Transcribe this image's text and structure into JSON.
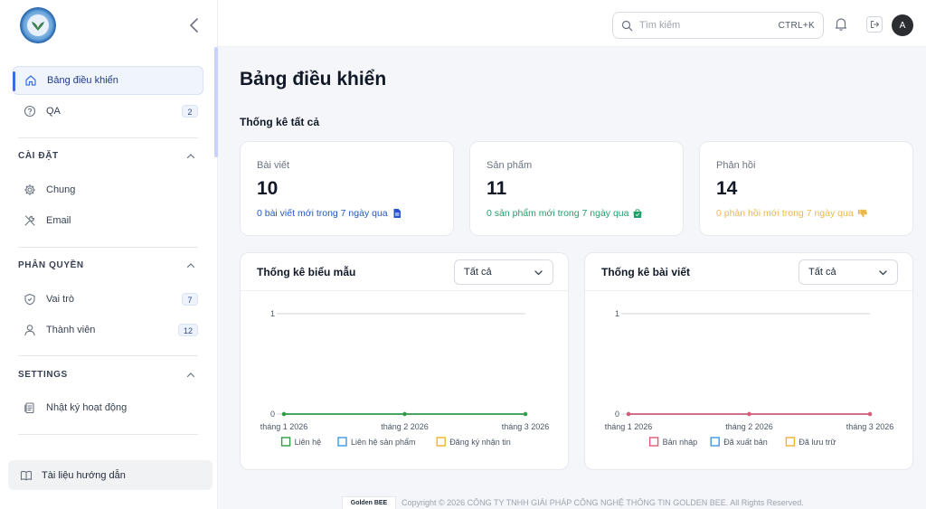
{
  "sidebar": {
    "nav": [
      {
        "label": "Bảng điều khiển",
        "icon": "home-icon",
        "active": true
      },
      {
        "label": "QA",
        "icon": "help-circle-icon",
        "badge": "2"
      }
    ],
    "sections": [
      {
        "title": "CÀI ĐẶT",
        "items": [
          {
            "label": "Chung",
            "icon": "gear-icon"
          },
          {
            "label": "Email",
            "icon": "tools-icon"
          }
        ]
      },
      {
        "title": "PHÂN QUYỀN",
        "items": [
          {
            "label": "Vai trò",
            "icon": "shield-icon",
            "badge": "7"
          },
          {
            "label": "Thành viên",
            "icon": "user-icon",
            "badge": "12"
          }
        ]
      },
      {
        "title": "SETTINGS",
        "items": [
          {
            "label": "Nhật ký hoạt động",
            "icon": "activity-log-icon"
          }
        ]
      }
    ],
    "docs_label": "Tài liệu hướng dẫn"
  },
  "topbar": {
    "search_placeholder": "Tìm kiếm",
    "search_shortcut": "CTRL+K",
    "avatar_initial": "A"
  },
  "main": {
    "title": "Bảng điều khiển",
    "stats_heading": "Thống kê tất cả",
    "stats": [
      {
        "label": "Bài viết",
        "value": "10",
        "note": "0 bài viết mới trong 7 ngày qua",
        "color": "#2457c5",
        "icon": "document-icon"
      },
      {
        "label": "Sản phẩm",
        "value": "11",
        "note": "0 sản phẩm mới trong 7 ngày qua",
        "color": "#22a06b",
        "icon": "shopping-bag-icon"
      },
      {
        "label": "Phản hồi",
        "value": "14",
        "note": "0 phản hồi mới trong 7 ngày qua",
        "color": "#e9b949",
        "icon": "thumbs-down-icon"
      }
    ]
  },
  "chart_data": [
    {
      "type": "line",
      "title": "Thống kê biểu mẫu",
      "filter": "Tất cả",
      "x": [
        "tháng 1 2026",
        "tháng 2 2026",
        "tháng 3 2026"
      ],
      "ylim": [
        0,
        1
      ],
      "yticks": [
        "0",
        "1"
      ],
      "legend_position": "bottom",
      "series": [
        {
          "name": "Liên hệ",
          "values": [
            0,
            0,
            0
          ],
          "color": "#2f9e44"
        },
        {
          "name": "Liên hệ sản phẩm",
          "values": [
            0,
            0,
            0
          ],
          "color": "#3b9ae1"
        },
        {
          "name": "Đăng ký nhận tin",
          "values": [
            0,
            0,
            0
          ],
          "color": "#f0b429"
        }
      ]
    },
    {
      "type": "line",
      "title": "Thống kê bài viết",
      "filter": "Tất cả",
      "x": [
        "tháng 1 2026",
        "tháng 2 2026",
        "tháng 3 2026"
      ],
      "ylim": [
        0,
        1
      ],
      "yticks": [
        "0",
        "1"
      ],
      "legend_position": "bottom",
      "series": [
        {
          "name": "Bản nháp",
          "values": [
            0,
            0,
            0
          ],
          "color": "#e05a78"
        },
        {
          "name": "Đã xuất bản",
          "values": [
            0,
            0,
            0
          ],
          "color": "#3b9ae1"
        },
        {
          "name": "Đã lưu trữ",
          "values": [
            0,
            0,
            0
          ],
          "color": "#f0b429"
        }
      ]
    }
  ],
  "footer": {
    "logo_text": "Golden BEE",
    "text": "Copyright © 2026 CÔNG TY TNHH GIẢI PHÁP CÔNG NGHỆ THÔNG TIN GOLDEN BEE. All Rights Reserved."
  }
}
